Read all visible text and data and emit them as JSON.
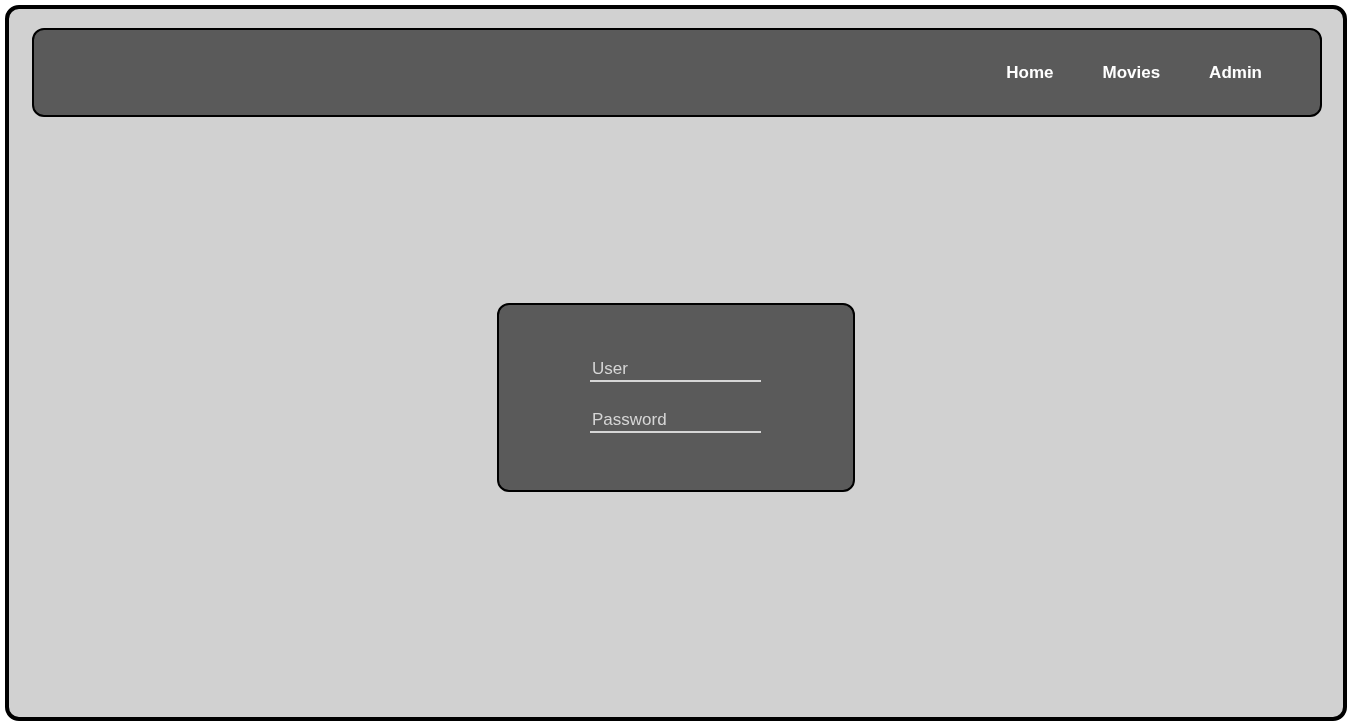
{
  "nav": {
    "links": [
      {
        "label": "Home"
      },
      {
        "label": "Movies"
      },
      {
        "label": "Admin"
      }
    ]
  },
  "login": {
    "fields": [
      {
        "placeholder": "User"
      },
      {
        "placeholder": "Password"
      }
    ]
  }
}
